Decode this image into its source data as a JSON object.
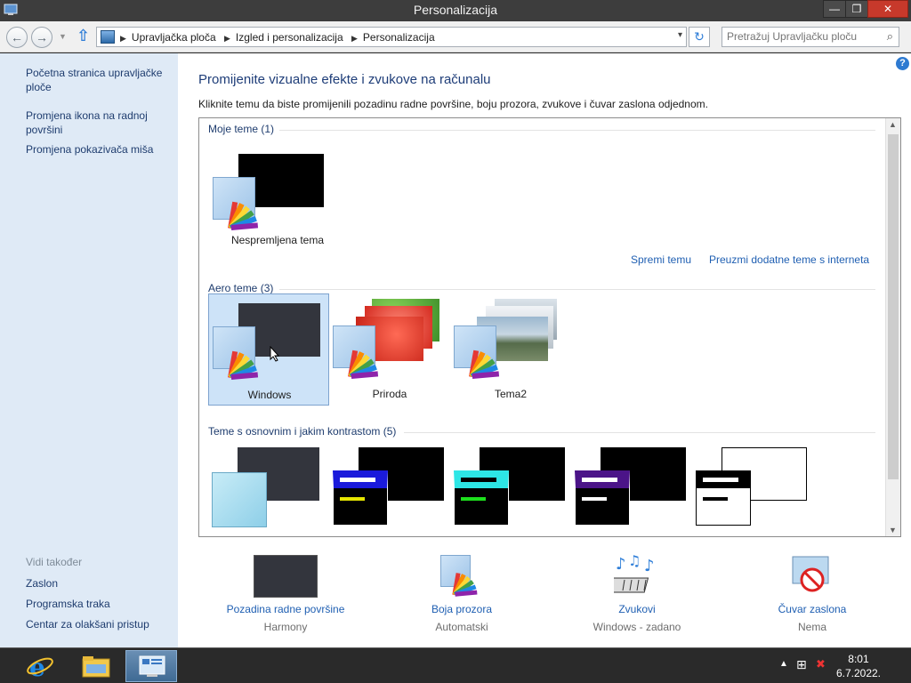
{
  "window": {
    "title": "Personalizacija"
  },
  "title_buttons": {
    "minimize": "—",
    "maximize": "❐",
    "close": "✕"
  },
  "address": {
    "crumbs": [
      "Upravljačka ploča",
      "Izgled i personalizacija",
      "Personalizacija"
    ]
  },
  "search": {
    "placeholder": "Pretražuj Upravljačku ploču"
  },
  "sidebar": {
    "links": [
      "Početna stranica upravljačke ploče",
      "Promjena ikona na radnoj površini",
      "Promjena pokazivača miša"
    ],
    "see_also_header": "Vidi također",
    "see_also": [
      "Zaslon",
      "Programska traka",
      "Centar za olakšani pristup"
    ]
  },
  "main": {
    "heading": "Promijenite vizualne efekte i zvukove na računalu",
    "subheading": "Kliknite temu da biste promijenili pozadinu radne površine, boju prozora, zvukove i čuvar zaslona odjednom.",
    "sections": {
      "my_themes": "Moje teme (1)",
      "aero_themes": "Aero teme (3)",
      "hc_themes": "Teme s osnovnim i jakim kontrastom (5)"
    },
    "my_themes": [
      {
        "label": "Nespremljena tema"
      }
    ],
    "actions": {
      "save": "Spremi temu",
      "download": "Preuzmi dodatne teme s interneta"
    },
    "aero_themes": [
      {
        "label": "Windows",
        "selected": true
      },
      {
        "label": "Priroda",
        "selected": false
      },
      {
        "label": "Tema2",
        "selected": false
      }
    ]
  },
  "bottom": [
    {
      "label": "Pozadina radne površine",
      "value": "Harmony",
      "icon": "desktop-background-icon"
    },
    {
      "label": "Boja prozora",
      "value": "Automatski",
      "icon": "window-color-icon"
    },
    {
      "label": "Zvukovi",
      "value": "Windows - zadano",
      "icon": "sounds-icon"
    },
    {
      "label": "Čuvar zaslona",
      "value": "Nema",
      "icon": "screensaver-icon"
    }
  ],
  "taskbar": {
    "time": "8:01",
    "date": "6.7.2022."
  },
  "colors": {
    "accent": "#1f5fb2",
    "sidebar_bg": "#dfeaf6",
    "selection": "#cde3f8"
  }
}
